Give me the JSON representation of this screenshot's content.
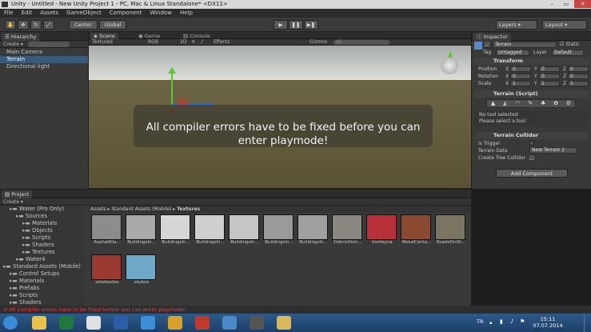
{
  "window": {
    "title": "Unity - Untitled - New Unity Project 1 - PC, Mac & Linux Standalone* <DX11>",
    "min": "–",
    "max": "▭",
    "close": "✕"
  },
  "menu": [
    "File",
    "Edit",
    "Assets",
    "GameObject",
    "Component",
    "Window",
    "Help"
  ],
  "toolbar": {
    "center": "Center",
    "global": "Global",
    "layers": "Layers",
    "layout": "Layout",
    "play": "▶",
    "pause": "❚❚",
    "step": "▶❚"
  },
  "hierarchy": {
    "tab": "Hierarchy",
    "create": "Create",
    "items": [
      "Main Camera",
      "Terrain",
      "Directional light"
    ],
    "selected": 1
  },
  "scene": {
    "tabs": [
      "Scene",
      "Game",
      "Console"
    ],
    "shading": "Textured",
    "rgb": "RGB",
    "twod": "2D",
    "effects": "Effects",
    "gizmos": "Gizmos",
    "search_placeholder": "All",
    "error_overlay": "All compiler errors have to be fixed before you can enter playmode!"
  },
  "inspector": {
    "tab": "Inspector",
    "object_name": "Terrain",
    "static_label": "Static",
    "tag_label": "Tag",
    "tag_value": "Untagged",
    "layer_label": "Layer",
    "layer_value": "Default",
    "transform": {
      "title": "Transform",
      "position": {
        "label": "Position",
        "x": "0",
        "y": "0",
        "z": "0"
      },
      "rotation": {
        "label": "Rotation",
        "x": "0",
        "y": "0",
        "z": "0"
      },
      "scale": {
        "label": "Scale",
        "x": "1",
        "y": "1",
        "z": "1"
      }
    },
    "terrain_script": {
      "title": "Terrain (Script)",
      "no_tool": "No tool selected",
      "select_tool": "Please select a tool"
    },
    "terrain_collider": {
      "title": "Terrain Collider",
      "is_trigger": "Is Trigger",
      "terrain_data": "Terrain Data",
      "terrain_data_value": "New Terrain 2",
      "create_tree": "Create Tree Collider"
    },
    "add_component": "Add Component"
  },
  "project": {
    "tab": "Project",
    "create": "Create",
    "tree": [
      {
        "label": "Water (Pro Only)",
        "indent": 1
      },
      {
        "label": "Sources",
        "indent": 2
      },
      {
        "label": "Materials",
        "indent": 3
      },
      {
        "label": "Objects",
        "indent": 3
      },
      {
        "label": "Scripts",
        "indent": 3
      },
      {
        "label": "Shaders",
        "indent": 3
      },
      {
        "label": "Textures",
        "indent": 3
      },
      {
        "label": "Water4",
        "indent": 2
      },
      {
        "label": "Standard Assets (Mobile)",
        "indent": 0
      },
      {
        "label": "Control Setups",
        "indent": 1
      },
      {
        "label": "Materials",
        "indent": 1
      },
      {
        "label": "Prefabs",
        "indent": 1
      },
      {
        "label": "Scripts",
        "indent": 1
      },
      {
        "label": "Shaders",
        "indent": 1
      },
      {
        "label": "Textures",
        "indent": 1
      }
    ],
    "breadcrumb": [
      "Assets",
      "Standard Assets (Mobile)",
      "Textures"
    ],
    "assets": [
      {
        "label": "AsphaltDa...",
        "color": "#8c8c8c"
      },
      {
        "label": "BuildingsIn...",
        "color": "#a9a9a9"
      },
      {
        "label": "BuildingsIn...",
        "color": "#d6d6d6"
      },
      {
        "label": "BuildingsIn...",
        "color": "#cfcfcf"
      },
      {
        "label": "BuildingsIn...",
        "color": "#c5c5c5"
      },
      {
        "label": "BuildingsIn...",
        "color": "#9a9a9a"
      },
      {
        "label": "BuildingsIn...",
        "color": "#a0a0a0"
      },
      {
        "label": "DebrisSton...",
        "color": "#8a8680"
      },
      {
        "label": "konteyna",
        "color": "#b8313a"
      },
      {
        "label": "MetalConta...",
        "color": "#8a4a32"
      },
      {
        "label": "RoadsDirtD...",
        "color": "#7a7560"
      },
      {
        "label": "sdadasdas",
        "color": "#9b3a30"
      },
      {
        "label": "skybox",
        "color": "#6fa9c8"
      }
    ]
  },
  "status_error": "All compiler errors have to be fixed before you can enter playmode!",
  "taskbar": {
    "lang": "TR",
    "time": "15:11",
    "date": "07.07.2014",
    "icons": [
      {
        "name": "start-orb-icon",
        "color": "#3b8ad8"
      },
      {
        "name": "explorer-icon",
        "color": "#e8c24a"
      },
      {
        "name": "excel-icon",
        "color": "#1f7a3a"
      },
      {
        "name": "yandex-icon",
        "color": "#e0e0e0"
      },
      {
        "name": "word-icon",
        "color": "#2b5ea8"
      },
      {
        "name": "ie-icon",
        "color": "#3a8fd8"
      },
      {
        "name": "chrome-icon",
        "color": "#d8a22a"
      },
      {
        "name": "filezilla-icon",
        "color": "#c03a2a"
      },
      {
        "name": "app-icon",
        "color": "#4a8ac8"
      },
      {
        "name": "unity-icon",
        "color": "#555555"
      },
      {
        "name": "folder-icon",
        "color": "#d8b85a"
      }
    ]
  }
}
